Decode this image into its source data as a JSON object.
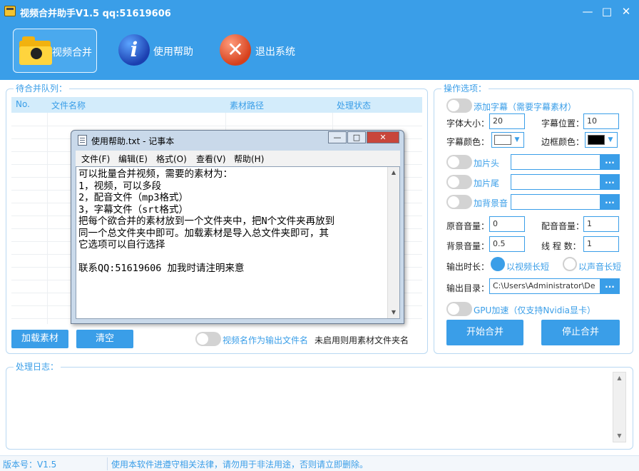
{
  "window": {
    "title": "视频合并助手V1.5 qq:51619606"
  },
  "toolbar": {
    "merge": "视频合并",
    "help": "使用帮助",
    "exit": "退出系统"
  },
  "queue": {
    "title": "待合并队列：",
    "columns": [
      "No.",
      "文件名称",
      "素材路径",
      "处理状态"
    ],
    "load_button": "加载素材",
    "clear_button": "清空",
    "name_toggle_label": "视频名作为输出文件名",
    "name_toggle_note": "未启用则用素材文件夹名"
  },
  "notepad": {
    "title": "使用帮助.txt - 记事本",
    "menu": [
      "文件(F)",
      "编辑(E)",
      "格式(O)",
      "查看(V)",
      "帮助(H)"
    ],
    "lines": [
      "可以批量合并视频，需要的素材为：",
      "1，视频，可以多段",
      "2，配音文件（mp3格式）",
      "3，字幕文件（srt格式）",
      "把每个欲合并的素材放到一个文件夹中，把N个文件夹再放到",
      "同一个总文件夹中即可。加载素材是导入总文件夹即可，其",
      "它选项可以自行选择",
      "",
      "联系QQ:51619606 加我时请注明来意"
    ]
  },
  "options": {
    "title": "操作选项：",
    "subtitle_toggle": "添加字幕（需要字幕素材）",
    "font_size_label": "字体大小：",
    "font_size_value": "20",
    "position_label": "字幕位置：",
    "position_value": "10",
    "font_color_label": "字幕颜色：",
    "font_color": "#ffffff",
    "border_color_label": "边框颜色：",
    "border_color": "#000000",
    "intro_toggle": "加片头",
    "outro_toggle": "加片尾",
    "bgm_toggle": "加背景音",
    "browse": "...",
    "orig_volume_label": "原音音量：",
    "orig_volume_value": "0",
    "dub_volume_label": "配音音量：",
    "dub_volume_value": "1",
    "bg_volume_label": "背景音量：",
    "bg_volume_value": "0.5",
    "threads_label": "线 程 数：",
    "threads_value": "1",
    "duration_label": "输出时长：",
    "duration_opt1": "以视频长短",
    "duration_opt2": "以声音长短",
    "outdir_label": "输出目录：",
    "outdir_value": "C:\\Users\\Administrator\\De",
    "gpu_toggle": "GPU加速（仅支持Nvidia显卡）",
    "start_button": "开始合并",
    "stop_button": "停止合并"
  },
  "log": {
    "title": "处理日志："
  },
  "status": {
    "version": "版本号：V1.5",
    "notice": "使用本软件进遵守相关法律，请勿用于非法用途，否则请立即删除。"
  },
  "colors": {
    "accent": "#3a9ee8",
    "header_bg": "#d3ecfb"
  }
}
